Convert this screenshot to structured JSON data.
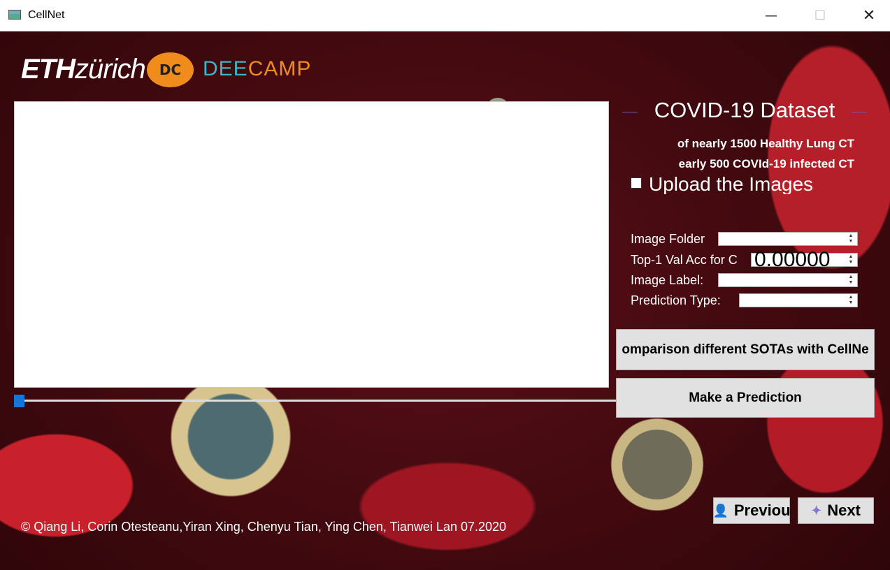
{
  "window": {
    "title": "CellNet",
    "minimize_glyph": "—",
    "maximize_glyph": "☐",
    "close_glyph": "✕"
  },
  "logos": {
    "eth_bold": "ETH",
    "eth_rest": "zürich",
    "dc_mark": "DC",
    "deecamp_a": "DEE",
    "deecamp_b": "CAMP"
  },
  "panel": {
    "section_title": "COVID-19  Dataset",
    "desc_line1": "of nearly 1500  Healthy  Lung CT",
    "desc_line2": "early  500  COVId-19  infected  CT",
    "upload_label": "Upload the Images",
    "upload_checked": false,
    "fields": {
      "image_folder_label": "Image Folder",
      "image_folder_value": "",
      "top1_label": "Top-1 Val  Acc for C",
      "top1_value": "0.00000",
      "image_label_label": "Image Label:",
      "image_label_value": "",
      "prediction_type_label": "Prediction Type:",
      "prediction_type_value": ""
    },
    "compare_button": "omparison different SOTAs with CellNe",
    "predict_button": "Make a Prediction"
  },
  "slider": {
    "value_fraction": 0.0
  },
  "nav": {
    "previous_label": "Previou",
    "next_label": "Next"
  },
  "footer": {
    "credits": "© Qiang Li, Corin Otesteanu,Yiran Xing, Chenyu Tian, Ying Chen, Tianwei Lan 07.2020"
  },
  "colors": {
    "slider_handle": "#1476d6",
    "button_bg": "#e1e1e1",
    "deecamp_blue": "#3ab6c8",
    "deecamp_orange": "#f08c1c"
  }
}
